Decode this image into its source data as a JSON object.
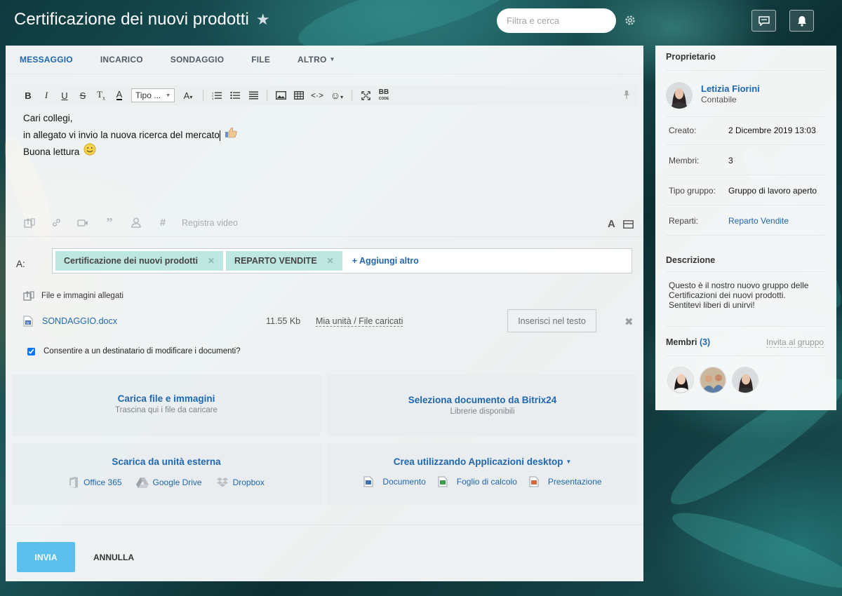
{
  "header": {
    "title": "Certificazione dei nuovi prodotti",
    "search_placeholder": "Filtra e cerca"
  },
  "tabs": [
    {
      "label": "MESSAGGIO"
    },
    {
      "label": "INCARICO"
    },
    {
      "label": "SONDAGGIO"
    },
    {
      "label": "FILE"
    },
    {
      "label": "ALTRO"
    }
  ],
  "toolbar": {
    "font_select": "Tipo ..."
  },
  "editor": {
    "lines": [
      "Cari collegi,",
      "in allegato vi invio la nuova ricerca del mercato",
      "Buona lettura"
    ]
  },
  "attach_bar": {
    "record_video": "Registra video"
  },
  "recipients": {
    "label": "A:",
    "chips": [
      "Certificazione dei nuovi prodotti",
      "REPARTO VENDITE"
    ],
    "add_more": "+ Aggiungi altro"
  },
  "files": {
    "title": "File e immagini allegati",
    "items": [
      {
        "name": "SONDAGGIO.docx",
        "size": "11.55 Kb",
        "location": "Mia unità / File caricati",
        "insert_label": "Inserisci nel testo"
      }
    ],
    "allow_edit_label": "Consentire a un destinatario di modificare i documenti?"
  },
  "upload": {
    "local": {
      "title": "Carica file e immagini",
      "subtitle": "Trascina qui i file da caricare"
    },
    "bitrix": {
      "title": "Seleziona documento da Bitrix24",
      "subtitle": "Librerie disponibili"
    },
    "external": {
      "title": "Scarica da unità esterna",
      "services": [
        "Office 365",
        "Google Drive",
        "Dropbox"
      ]
    },
    "desktop": {
      "title": "Crea utilizzando Applicazioni desktop",
      "apps": [
        "Documento",
        "Foglio di calcolo",
        "Presentazione"
      ]
    }
  },
  "actions": {
    "send": "INVIA",
    "cancel": "ANNULLA"
  },
  "sidebar": {
    "owner_title": "Proprietario",
    "owner_name": "Letizia Fiorini",
    "owner_role": "Contabile",
    "info": [
      {
        "key": "Creato:",
        "value": "2 Dicembre 2019 13:03"
      },
      {
        "key": "Membri:",
        "value": "3"
      },
      {
        "key": "Tipo gruppo:",
        "value": "Gruppo di lavoro aperto"
      },
      {
        "key": "Reparti:",
        "value": "Reparto Vendite"
      }
    ],
    "description_title": "Descrizione",
    "description": "Questo è il nostro nuovo gruppo delle Certificazioni dei nuovi prodotti. Sentitevi liberi di unirvi!",
    "members_title": "Membri",
    "members_count": "(3)",
    "invite_label": "Invita al gruppo"
  },
  "colors": {
    "accent": "#2067b0",
    "send_button": "#5cc0ec",
    "chip": "#bfe7e1"
  }
}
